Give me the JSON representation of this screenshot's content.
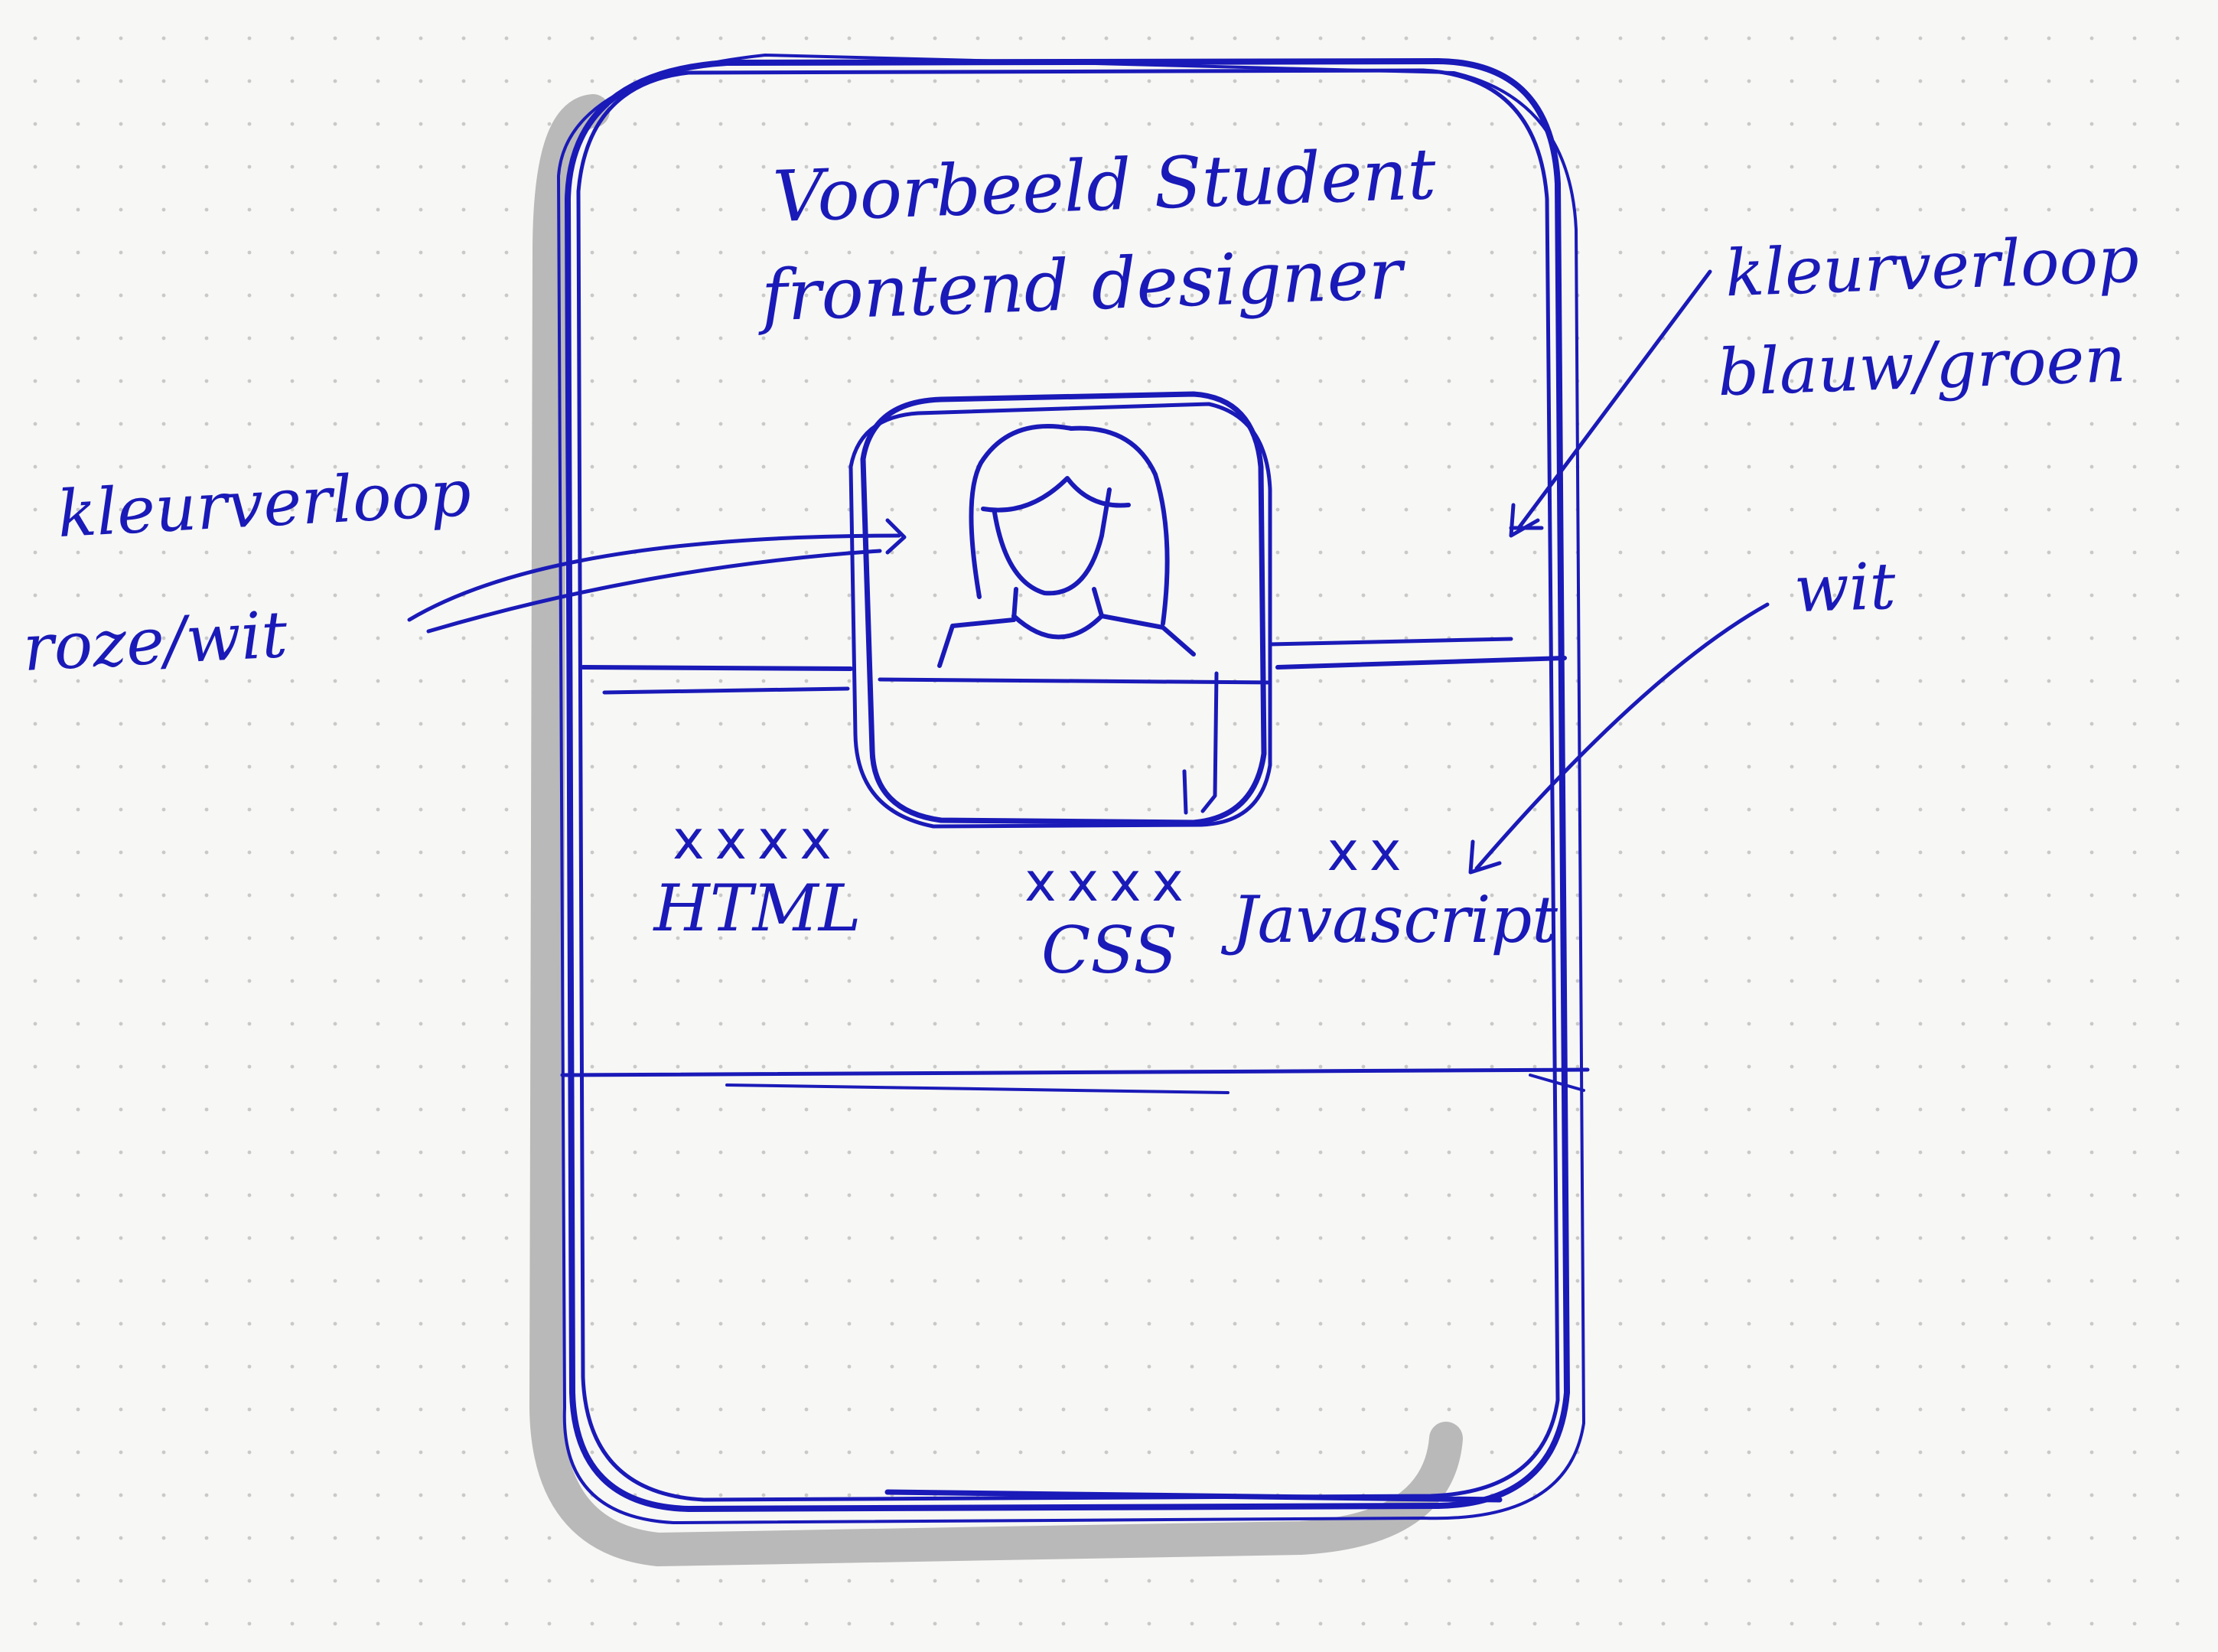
{
  "colors": {
    "ink": "#1a1ab8",
    "shadow": "#b9b9b9",
    "paper": "#f7f7f5",
    "dots": "#c9c9c9"
  },
  "title": {
    "line1": "Voorbeeld Student",
    "line2": "frontend designer"
  },
  "annotations": {
    "left": {
      "line1": "kleurverloop",
      "line2": "roze/wit"
    },
    "right_top": {
      "line1": "kleurverloop",
      "line2": "blauw/groen"
    },
    "right_mid": "wit"
  },
  "skills": [
    {
      "rating": "xxxx",
      "label": "HTML"
    },
    {
      "rating": "xxxx",
      "label": "CSS"
    },
    {
      "rating": "xx",
      "label": "Javascript"
    }
  ],
  "icons": {
    "avatar": "person-avatar-icon"
  }
}
